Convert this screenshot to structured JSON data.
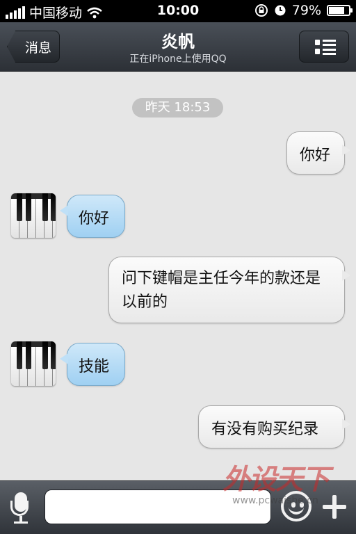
{
  "status_bar": {
    "carrier": "中国移动",
    "time": "10:00",
    "battery_percent": "79%",
    "battery_level": 0.79
  },
  "nav": {
    "back_label": "消息",
    "title": "炎帆",
    "subtitle": "正在iPhone上使用QQ",
    "menu_icon": "list-icon"
  },
  "chat": {
    "timestamp": "昨天 18:53",
    "messages": [
      {
        "side": "out",
        "text": "你好"
      },
      {
        "side": "in",
        "text": "你好"
      },
      {
        "side": "out",
        "text": "问下键帽是主任今年的款还是以前的"
      },
      {
        "side": "in",
        "text": "技能"
      },
      {
        "side": "out",
        "text": "有没有购买纪录"
      }
    ]
  },
  "input_bar": {
    "mic_icon": "microphone-icon",
    "input_value": "",
    "emoji_icon": "smiley-icon",
    "add_icon": "plus-icon"
  },
  "watermark": {
    "brand": "外设天下",
    "url": "www.pcwaishe.cn"
  },
  "colors": {
    "incoming_bubble": "#a9d6f5",
    "outgoing_bubble": "#f2f2f2",
    "chat_background": "#e6e6e6",
    "navbar": "#3a3f46"
  }
}
